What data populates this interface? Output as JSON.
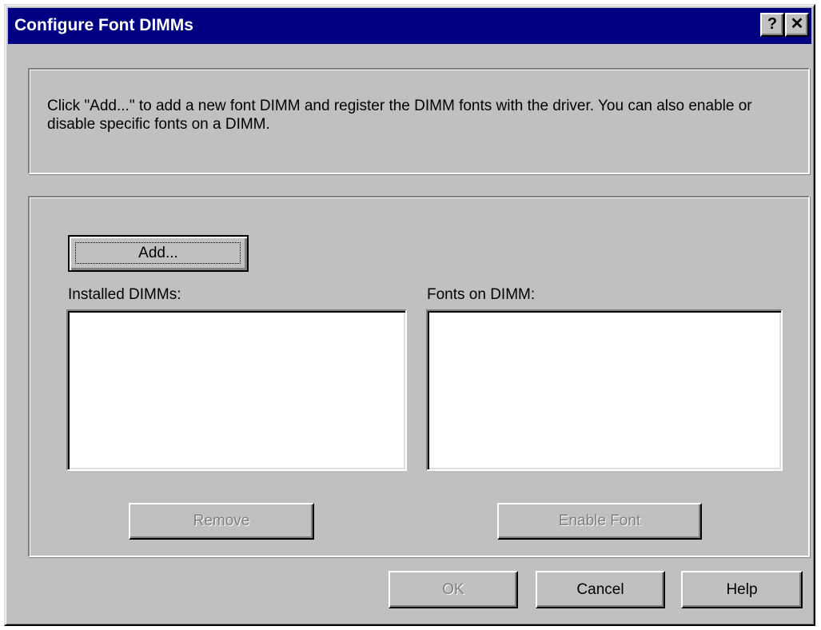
{
  "window": {
    "title": "Configure Font DIMMs",
    "help_button": "?",
    "close_button": "✕"
  },
  "info": {
    "text": "Click \"Add...\" to add a new font DIMM and register the DIMM fonts with the driver.  You can also enable or disable specific fonts on a DIMM."
  },
  "main": {
    "add_button": "Add...",
    "installed_label": "Installed DIMMs:",
    "installed_items": [],
    "fonts_label": "Fonts on DIMM:",
    "fonts_items": [],
    "remove_button": "Remove",
    "enable_font_button": "Enable Font"
  },
  "footer": {
    "ok_button": "OK",
    "cancel_button": "Cancel",
    "help_button": "Help"
  }
}
